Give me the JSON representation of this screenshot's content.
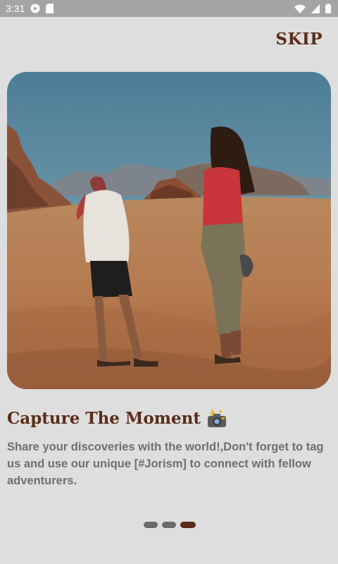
{
  "status_bar": {
    "time": "3:31",
    "left_icons": [
      "play-protect-icon",
      "sd-card-icon"
    ],
    "right_icons": [
      "wifi-icon",
      "cell-signal-icon",
      "battery-icon"
    ]
  },
  "onboarding": {
    "skip_label": "SKIP",
    "hero_image": "hero-photo-desert-couple",
    "title": "Capture The Moment",
    "title_icon": "camera-flash-icon",
    "description": "Share your discoveries with the world!,Don't forget to tag us and use our unique [#Jorism] to connect with fellow adventurers.",
    "page_indicator": {
      "total": 3,
      "current": 3
    }
  },
  "colors": {
    "background": "#dedede",
    "accent_brown": "#5a2d18",
    "text_gray": "#6f6f6f",
    "dot_inactive": "#6a6a6a",
    "status_bar": "#a4a4a4"
  }
}
